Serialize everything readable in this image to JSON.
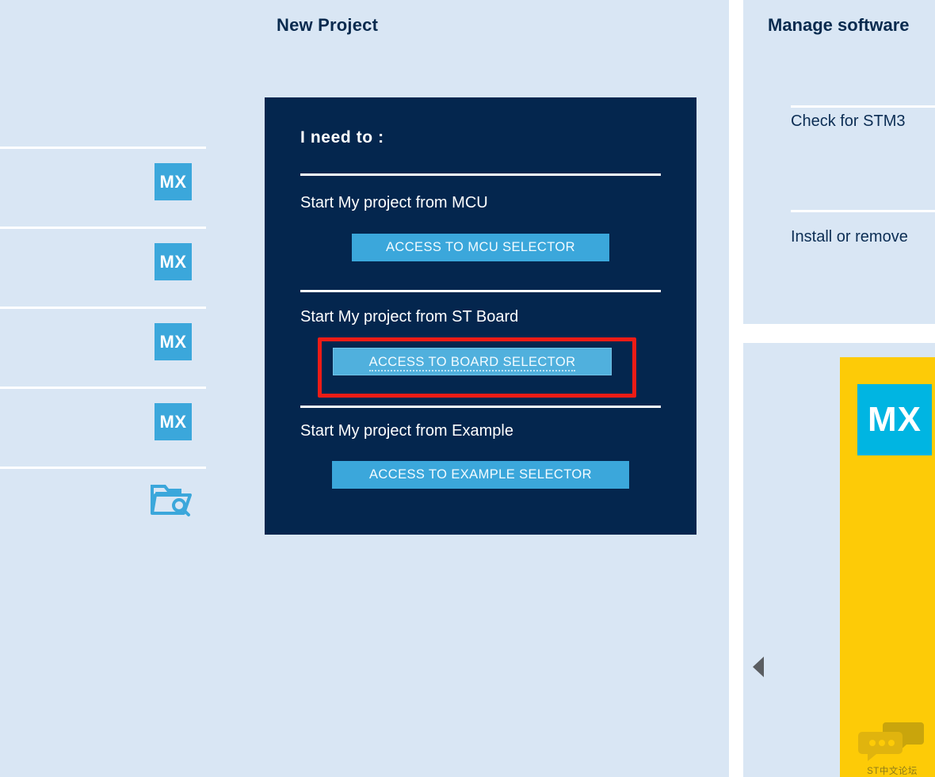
{
  "page": {
    "title": "New Project",
    "background_color": "#d9e6f4",
    "card_color": "#04264e",
    "accent_blue": "#3ba7db",
    "highlight_color": "#ee1c16",
    "banner_yellow": "#fdcb07"
  },
  "recent_projects": {
    "items": [
      {
        "icon": "mx-icon",
        "label": "MX"
      },
      {
        "icon": "mx-icon",
        "label": "MX"
      },
      {
        "icon": "mx-icon",
        "label": "MX"
      },
      {
        "icon": "mx-icon",
        "label": "MX"
      }
    ],
    "browse": {
      "icon": "folder-search-icon"
    }
  },
  "need_card": {
    "heading": "I need to :",
    "options": [
      {
        "label": "Start My project from MCU",
        "button": "ACCESS TO MCU SELECTOR"
      },
      {
        "label": "Start My project from ST Board",
        "button": "ACCESS TO BOARD SELECTOR"
      },
      {
        "label": "Start My project from Example",
        "button": "ACCESS TO EXAMPLE SELECTOR"
      }
    ]
  },
  "manage_software": {
    "title": "Manage software",
    "items": [
      "Check for STM3",
      "Install or remove"
    ]
  },
  "banner": {
    "logo_text": "MX",
    "watermark_text": "ST中文论坛",
    "watermark_icon": "chat-bubbles-icon"
  },
  "collapse_control": {
    "icon": "caret-left-icon"
  }
}
